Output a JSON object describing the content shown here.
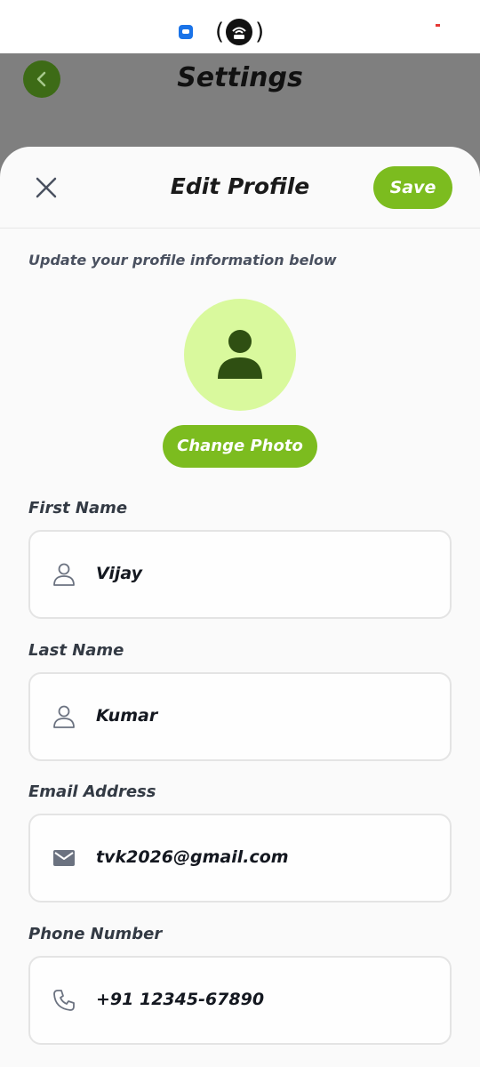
{
  "background_screen": {
    "title": "Settings"
  },
  "sheet": {
    "title": "Edit Profile",
    "save_label": "Save",
    "subtitle": "Update your profile information below",
    "change_photo_label": "Change Photo"
  },
  "fields": [
    {
      "label": "First Name",
      "value": "Vijay",
      "icon": "person-outline-icon"
    },
    {
      "label": "Last Name",
      "value": "Kumar",
      "icon": "person-outline-icon"
    },
    {
      "label": "Email Address",
      "value": "tvk2026@gmail.com",
      "icon": "mail-icon"
    },
    {
      "label": "Phone Number",
      "value": "+91 12345-67890",
      "icon": "phone-icon"
    }
  ],
  "colors": {
    "accent": "#7cbc1f",
    "avatar_bg": "#d9f99d",
    "avatar_icon": "#2f4f12",
    "back_button": "#3d6b16",
    "overlay": "#7f7f7f"
  }
}
